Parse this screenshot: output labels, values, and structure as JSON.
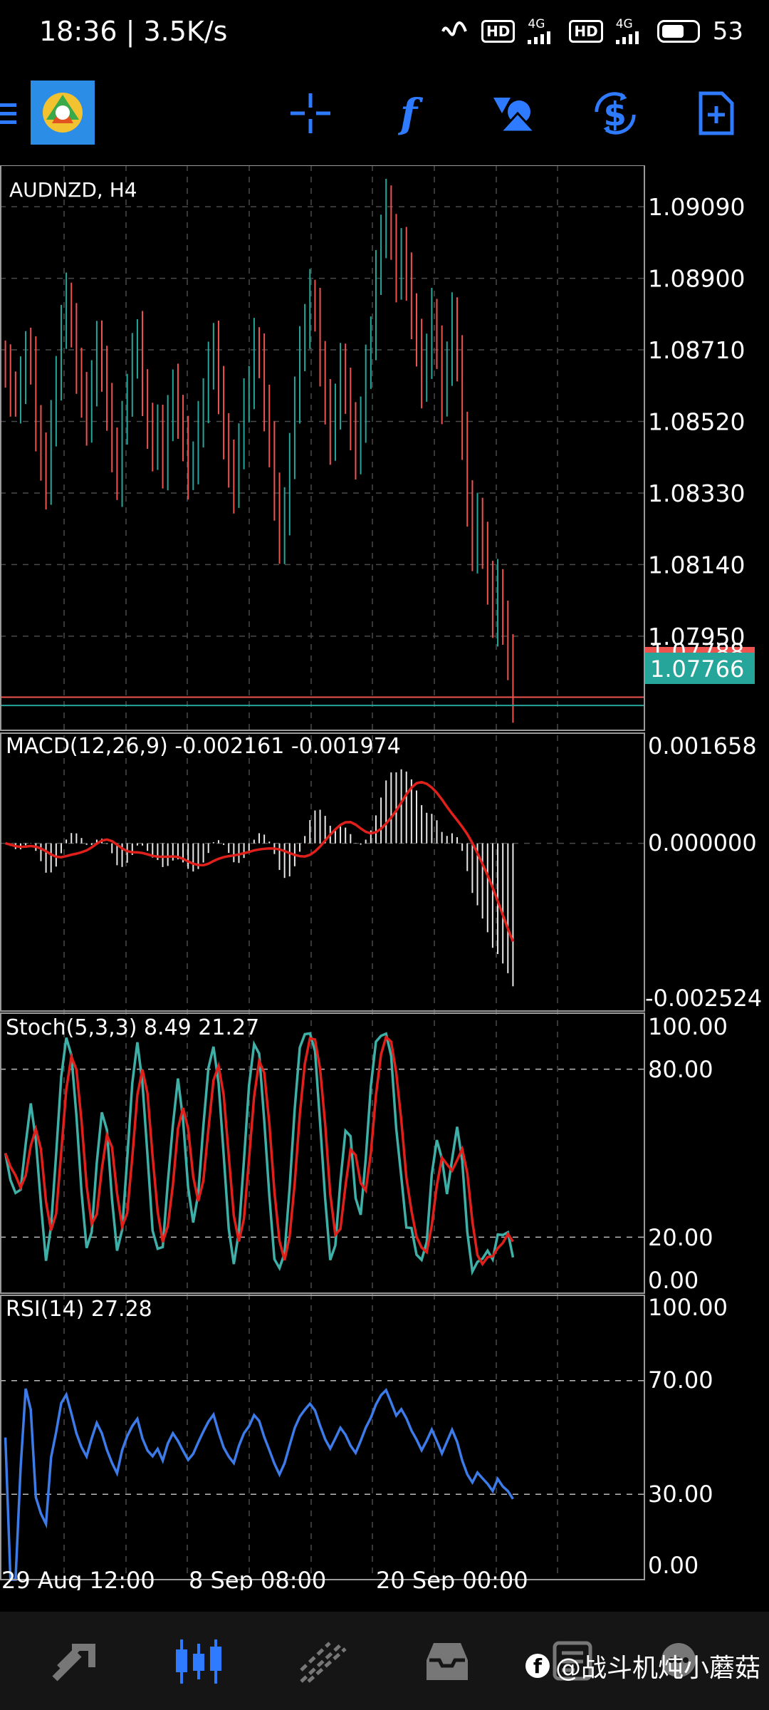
{
  "status_bar": {
    "time": "18:36 | 3.5K/s",
    "hd_1": "HD",
    "net_1": "4G",
    "hd_2": "HD",
    "net_2": "4G",
    "battery": "53"
  },
  "toolbar": {
    "icons": [
      "menu-icon",
      "metatrader-logo",
      "crosshair-icon",
      "indicators-icon",
      "objects-icon",
      "timeframe-icon",
      "new-order-icon"
    ],
    "accent": "#2f7bff"
  },
  "chart": {
    "symbol_label": "AUDNZD, H4",
    "price_ticks": [
      "1.09090",
      "1.08900",
      "1.08710",
      "1.08520",
      "1.08330",
      "1.08140",
      "1.07950"
    ],
    "ask_label": "1.07788",
    "bid_label": "1.07766",
    "macd": {
      "label": "MACD(12,26,9) -0.002161 -0.001974",
      "ticks": [
        "0.001658",
        "0.000000",
        "-0.002524"
      ]
    },
    "stoch": {
      "label": "Stoch(5,3,3) 8.49 21.27",
      "ticks": [
        "100.00",
        "80.00",
        "20.00",
        "0.00"
      ]
    },
    "rsi": {
      "label": "RSI(14) 27.28",
      "ticks": [
        "100.00",
        "70.00",
        "30.00",
        "0.00"
      ]
    },
    "time_labels": [
      "29 Aug 12:00",
      "8 Sep 08:00",
      "20 Sep 00:00"
    ],
    "colors": {
      "bull": "#26a69a",
      "bear": "#ef5350",
      "macd_signal": "#e0201b",
      "stoch_main": "#3fb0a8",
      "stoch_signal": "#e0201b",
      "rsi": "#3d7be8",
      "grid": "#4a4a4a",
      "bid_line": "#26a69a",
      "ask_line": "#ef5350"
    }
  },
  "chart_data": [
    {
      "type": "candlestick",
      "title": "AUDNZD, H4",
      "ylim": [
        1.077,
        1.092
      ],
      "last_bid": 1.07766,
      "last_ask": 1.07788,
      "close": [
        1.0865,
        1.086,
        1.0858,
        1.0862,
        1.087,
        1.0868,
        1.085,
        1.0842,
        1.0835,
        1.0852,
        1.0862,
        1.0878,
        1.0884,
        1.0876,
        1.0866,
        1.0858,
        1.0852,
        1.0862,
        1.0872,
        1.0866,
        1.0855,
        1.0845,
        1.0836,
        1.085,
        1.086,
        1.0868,
        1.0874,
        1.086,
        1.085,
        1.0845,
        1.085,
        1.084,
        1.0852,
        1.086,
        1.0854,
        1.0846,
        1.0838,
        1.0842,
        1.085,
        1.0858,
        1.0866,
        1.0872,
        1.086,
        1.0848,
        1.084,
        1.0834,
        1.0846,
        1.0856,
        1.0862,
        1.0872,
        1.0868,
        1.0856,
        1.0845,
        1.0832,
        1.082,
        1.0828,
        1.0842,
        1.0858,
        1.087,
        1.0878,
        1.0885,
        1.088,
        1.0868,
        1.0856,
        1.0847,
        1.0856,
        1.0866,
        1.086,
        1.085,
        1.0843,
        1.0853,
        1.0865,
        1.0875,
        1.089,
        1.0902,
        1.0909,
        1.09,
        1.089,
        1.0897,
        1.089,
        1.088,
        1.0872,
        1.0862,
        1.087,
        1.088,
        1.087,
        1.0858,
        1.0868,
        1.0879,
        1.0868,
        1.0848,
        1.083,
        1.0818,
        1.0826,
        1.0818,
        1.081,
        1.0799,
        1.0808,
        1.0797,
        1.079,
        1.0777
      ],
      "macd": {
        "ylim": [
          -0.002524,
          0.001658
        ]
      },
      "stoch": {
        "ylim": [
          0,
          100
        ],
        "levels": [
          20,
          80
        ]
      },
      "rsi": {
        "ylim": [
          0,
          100
        ],
        "levels": [
          30,
          70
        ]
      }
    }
  ],
  "watermark": {
    "fb": "f",
    "text": "@战斗机炖小蘑菇"
  },
  "bottom_nav": {
    "icons": [
      "quotes-icon",
      "chart-icon",
      "trade-icon",
      "history-icon",
      "messages-icon",
      "chat-icon"
    ]
  }
}
